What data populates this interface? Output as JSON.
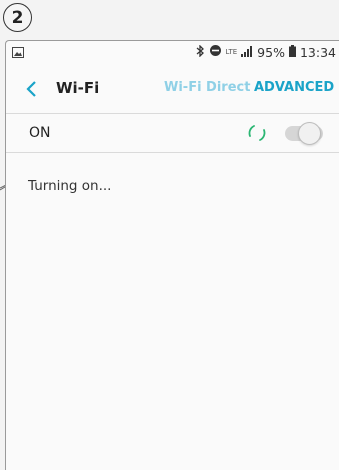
{
  "step_badge": "2",
  "status_bar": {
    "network": "LTE",
    "battery": "95%",
    "time": "13:34"
  },
  "app_bar": {
    "title": "Wi-Fi",
    "wifi_direct": "Wi-Fi Direct",
    "advanced": "ADVANCED"
  },
  "wifi_toggle": {
    "label": "ON",
    "state": "turning on"
  },
  "status_message": "Turning on...",
  "colors": {
    "accent": "#1aa3c8",
    "accent_light": "#8fd0e6",
    "spinner": "#2bb673"
  }
}
